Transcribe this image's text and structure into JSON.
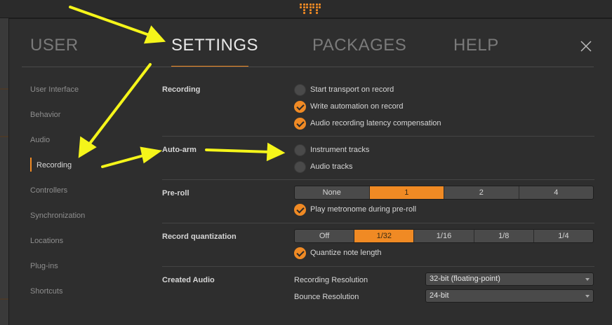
{
  "colors": {
    "accent": "#f08a24",
    "annotation": "#f5f51a"
  },
  "tabs": [
    {
      "label": "USER"
    },
    {
      "label": "SETTINGS"
    },
    {
      "label": "PACKAGES"
    },
    {
      "label": "HELP"
    }
  ],
  "close_icon": "close-icon",
  "sidebar": {
    "items": [
      {
        "label": "User Interface"
      },
      {
        "label": "Behavior"
      },
      {
        "label": "Audio"
      },
      {
        "label": "Recording"
      },
      {
        "label": "Controllers"
      },
      {
        "label": "Synchronization"
      },
      {
        "label": "Locations"
      },
      {
        "label": "Plug-ins"
      },
      {
        "label": "Shortcuts"
      }
    ],
    "active": "Recording"
  },
  "sections": {
    "recording": {
      "label": "Recording",
      "options": [
        {
          "label": "Start transport on record",
          "checked": false
        },
        {
          "label": "Write automation on record",
          "checked": true
        },
        {
          "label": "Audio recording latency compensation",
          "checked": true
        }
      ]
    },
    "autoarm": {
      "label": "Auto-arm",
      "options": [
        {
          "label": "Instrument tracks",
          "checked": false
        },
        {
          "label": "Audio tracks",
          "checked": false
        }
      ]
    },
    "preroll": {
      "label": "Pre-roll",
      "segments": [
        "None",
        "1",
        "2",
        "4"
      ],
      "selected": "1",
      "option": {
        "label": "Play metronome during pre-roll",
        "checked": true
      }
    },
    "quantization": {
      "label": "Record quantization",
      "segments": [
        "Off",
        "1/32",
        "1/16",
        "1/8",
        "1/4"
      ],
      "selected": "1/32",
      "option": {
        "label": "Quantize note length",
        "checked": true
      }
    },
    "created_audio": {
      "label": "Created Audio",
      "recording_resolution": {
        "label": "Recording Resolution",
        "value": "32-bit (floating-point)"
      },
      "bounce_resolution": {
        "label": "Bounce Resolution",
        "value": "24-bit"
      }
    }
  }
}
